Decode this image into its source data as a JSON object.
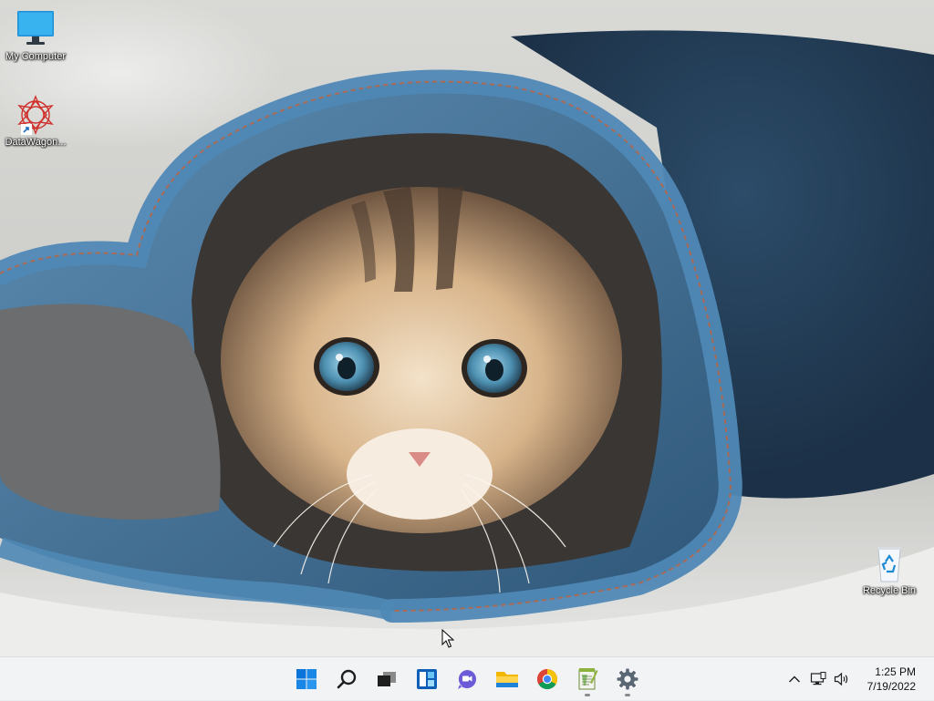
{
  "desktop": {
    "icons": [
      {
        "label": "My Computer",
        "icon": "monitor-icon"
      },
      {
        "label": "DataWagon...",
        "icon": "datawagon-icon"
      },
      {
        "label": "Recycle Bin",
        "icon": "recycle-bin-icon"
      }
    ]
  },
  "taskbar": {
    "apps": [
      {
        "label": "Start",
        "icon": "windows-start-icon",
        "running": false
      },
      {
        "label": "Search",
        "icon": "search-icon",
        "running": false
      },
      {
        "label": "Task View",
        "icon": "task-view-icon",
        "running": false
      },
      {
        "label": "Widgets",
        "icon": "widgets-icon",
        "running": false
      },
      {
        "label": "Chat",
        "icon": "chat-icon",
        "running": false
      },
      {
        "label": "File Explorer",
        "icon": "folder-icon",
        "running": false
      },
      {
        "label": "Google Chrome",
        "icon": "chrome-icon",
        "running": false
      },
      {
        "label": "Notepad++",
        "icon": "notepad-plus-plus-icon",
        "running": true
      },
      {
        "label": "Settings",
        "icon": "settings-gear-icon",
        "running": true
      }
    ],
    "tray": {
      "icons": [
        "chevron-up-icon",
        "network-icon",
        "speaker-icon"
      ],
      "time": "1:25 PM",
      "date": "7/19/2022"
    }
  }
}
